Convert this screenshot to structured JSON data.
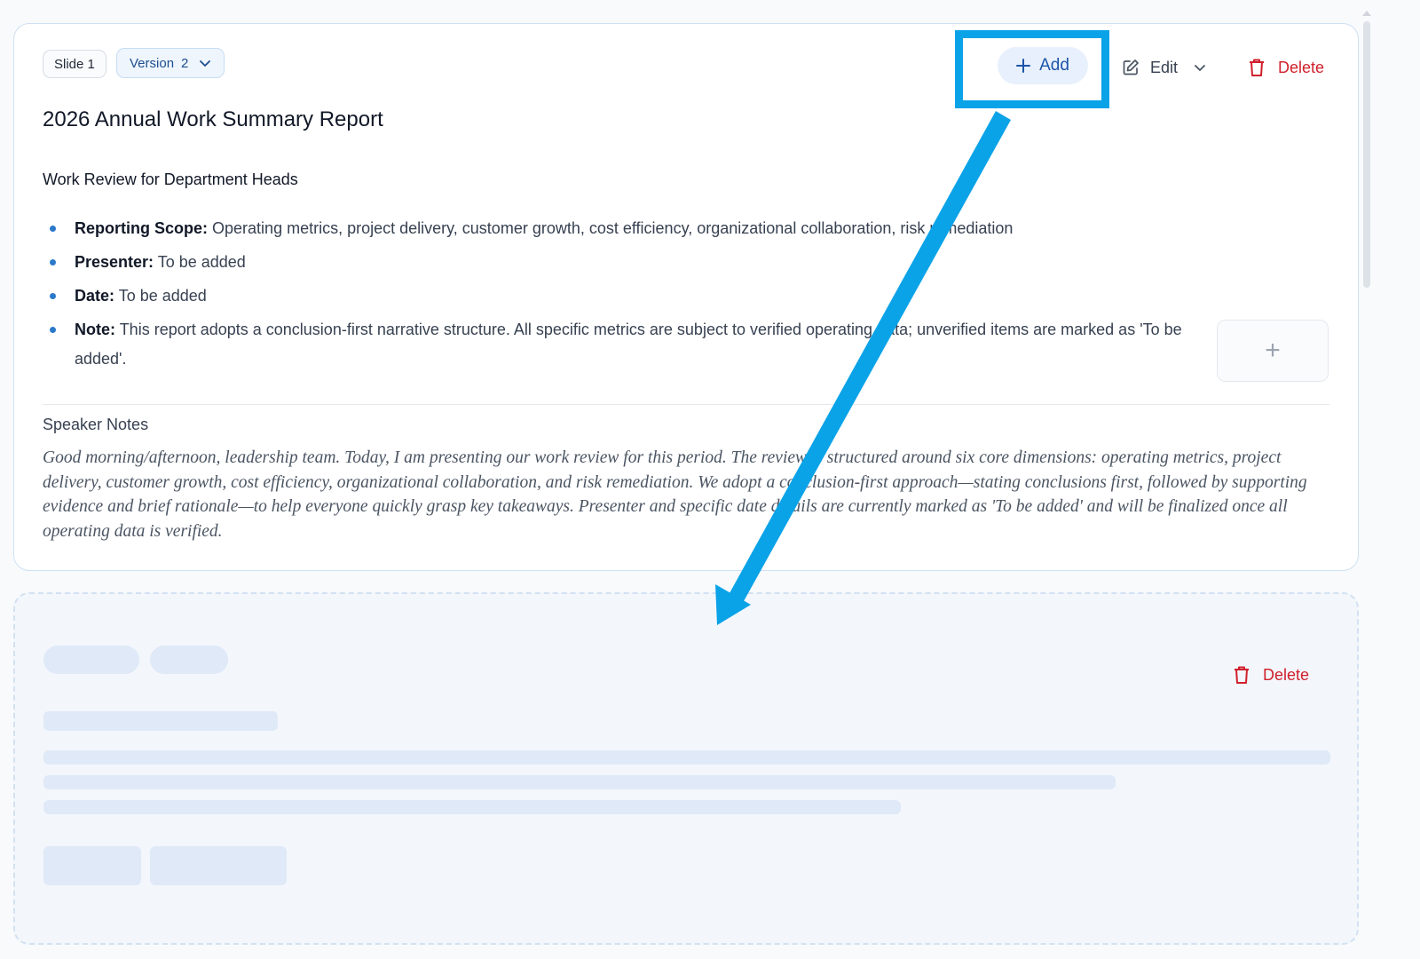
{
  "slide": {
    "slide_label": "Slide 1",
    "version_label": "Version",
    "version_number": "2",
    "toolbar": {
      "add_label": "Add",
      "edit_label": "Edit",
      "delete_label": "Delete"
    },
    "title": "2026 Annual Work Summary Report",
    "subtitle": "Work Review for Department Heads",
    "bullets": [
      {
        "label": "Reporting Scope:",
        "text": "Operating metrics, project delivery, customer growth, cost efficiency, organizational collaboration, risk remediation"
      },
      {
        "label": "Presenter:",
        "text": "To be added"
      },
      {
        "label": "Date:",
        "text": "To be added"
      },
      {
        "label": "Note:",
        "text": "This report adopts a conclusion-first narrative structure. All specific metrics are subject to verified operating data; unverified items are marked as 'To be added'."
      }
    ],
    "add_element_glyph": "+",
    "notes_title": "Speaker Notes",
    "notes_body": "Good morning/afternoon, leadership team. Today, I am presenting our work review for this period. The review is structured around six core dimensions: operating metrics, project delivery, customer growth, cost efficiency, organizational collaboration, and risk remediation. We adopt a conclusion-first approach—stating conclusions first, followed by supporting evidence and brief rationale—to help everyone quickly grasp key takeaways. Presenter and specific date details are currently marked as 'To be added' and will be finalized once all operating data is verified."
  },
  "loading_slide": {
    "delete_label": "Delete"
  },
  "colors": {
    "accent": "#1d55a8",
    "danger": "#d0202b",
    "annotation": "#0aa3e8"
  }
}
